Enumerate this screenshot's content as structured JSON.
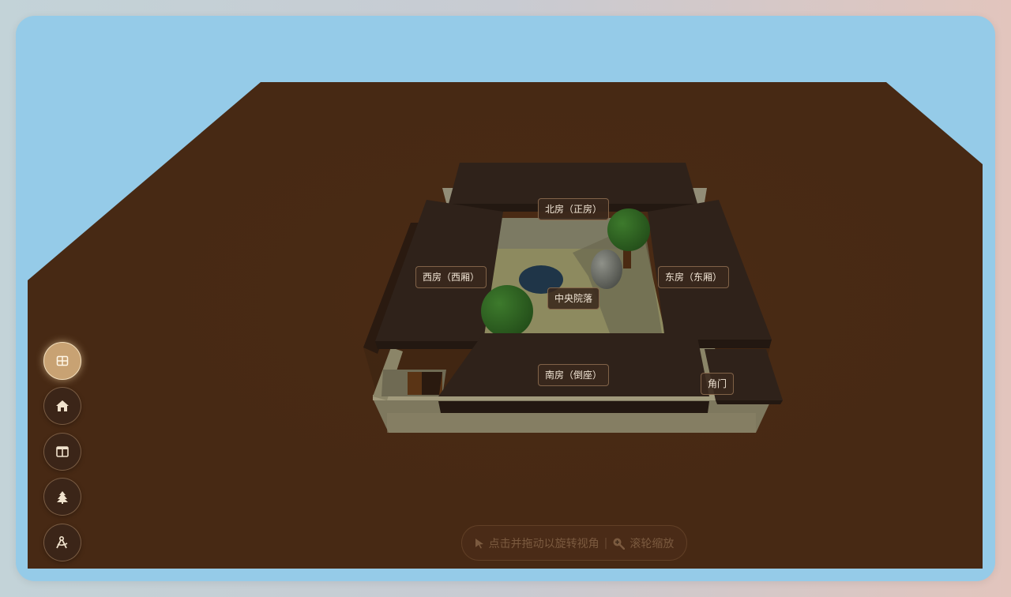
{
  "scene": {
    "labels": {
      "north": "北房（正房）",
      "west": "西房（西厢）",
      "east": "东房（东厢）",
      "courtyard": "中央院落",
      "south": "南房（倒座）",
      "corner_gate": "角门"
    }
  },
  "toolbar": {
    "items": [
      {
        "name": "overview-view",
        "icon": "grid-icon",
        "active": true
      },
      {
        "name": "house-view",
        "icon": "home-icon",
        "active": false
      },
      {
        "name": "layout-view",
        "icon": "layout-panel-icon",
        "active": false
      },
      {
        "name": "tree-view",
        "icon": "tree-icon",
        "active": false
      },
      {
        "name": "compass-view",
        "icon": "compass-icon",
        "active": false
      }
    ]
  },
  "hint": {
    "rotate_icon": "pointer-icon",
    "rotate_text": "点击并拖动以旋转视角",
    "separator": "|",
    "zoom_icon": "zoom-icon",
    "zoom_text": "滚轮缩放"
  },
  "colors": {
    "sky": "#95cbe8",
    "ground": "#472914",
    "roof": "#2f221a",
    "wall": "#7b7661",
    "courtyard": "#8d8a5f",
    "pond": "#1f3548",
    "tree": "#2f6423",
    "accent": "#c8a273"
  }
}
